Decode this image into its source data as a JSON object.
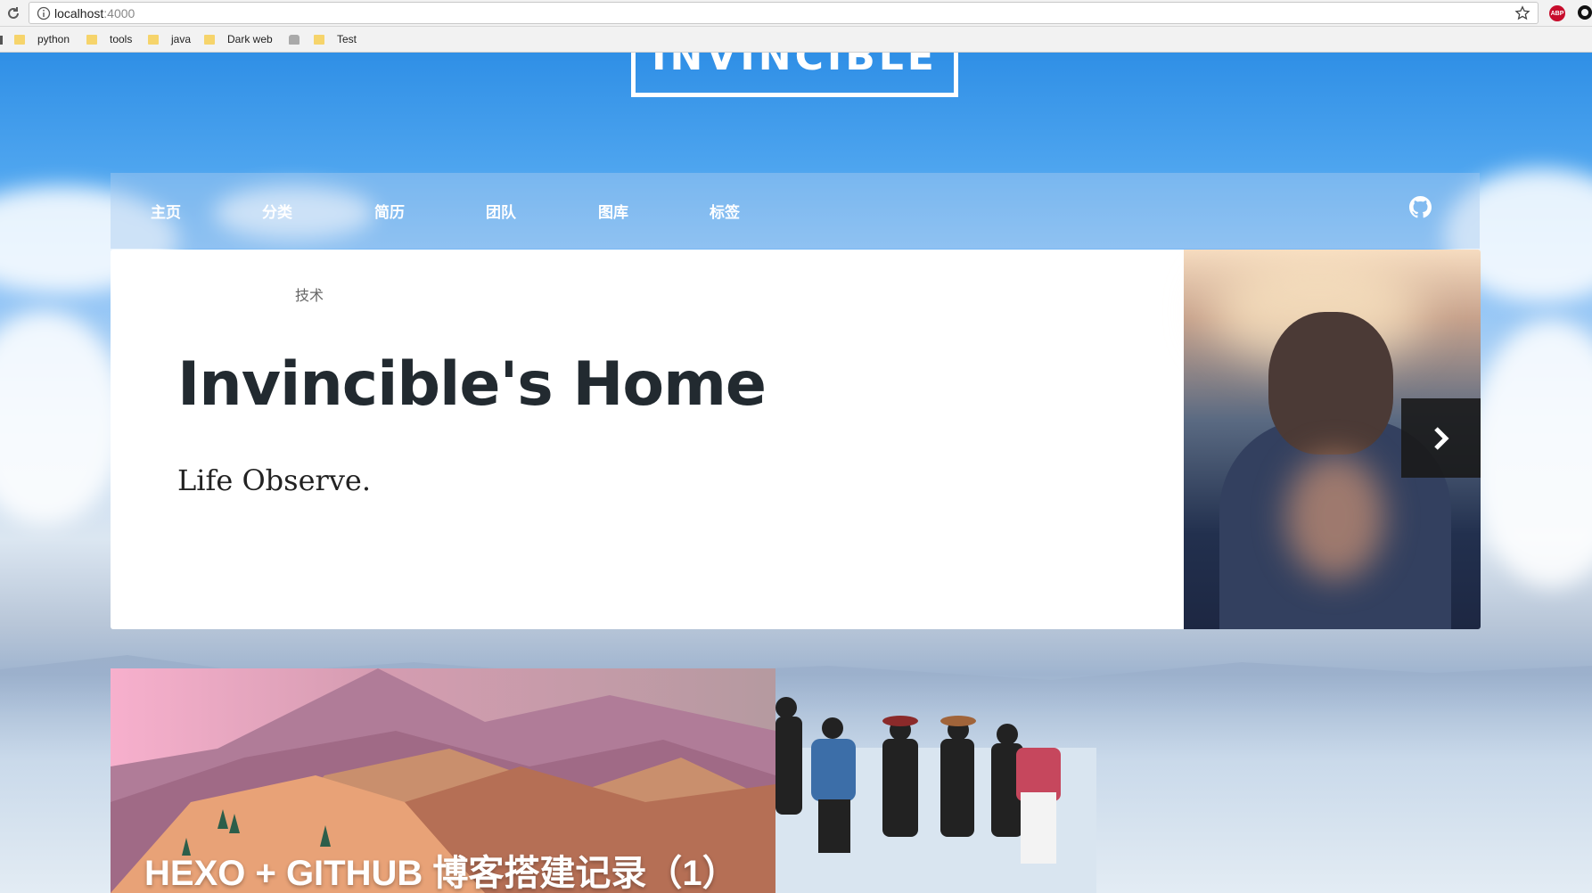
{
  "browser": {
    "url_host": "localhost",
    "url_port": ":4000",
    "abp_label": "ABP",
    "bookmarks": [
      "python",
      "tools",
      "java",
      "Dark web",
      "",
      "Test"
    ]
  },
  "site": {
    "title": "INVINCIBLE"
  },
  "nav": {
    "items": [
      "主页",
      "分类",
      "简历",
      "团队",
      "图库",
      "标签"
    ]
  },
  "hero": {
    "category": "技术",
    "title": "Invincible's Home",
    "subtitle": "Life Observe."
  },
  "post": {
    "title": "HEXO + GITHUB 博客搭建记录（1）"
  },
  "colors": {
    "sky_top": "#2f8fe6",
    "title_text": "#222a30",
    "next_button": "#191919"
  }
}
